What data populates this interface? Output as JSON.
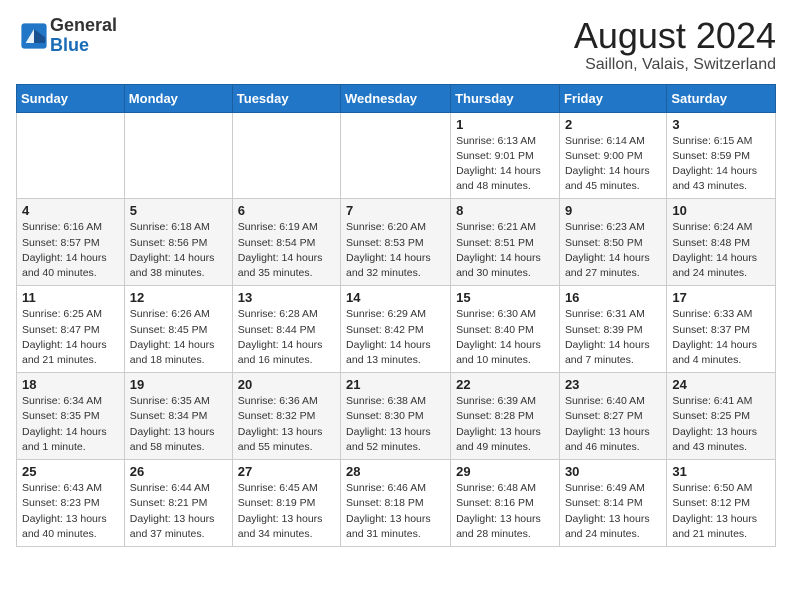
{
  "logo": {
    "line1": "General",
    "line2": "Blue"
  },
  "title": "August 2024",
  "subtitle": "Saillon, Valais, Switzerland",
  "days_of_week": [
    "Sunday",
    "Monday",
    "Tuesday",
    "Wednesday",
    "Thursday",
    "Friday",
    "Saturday"
  ],
  "weeks": [
    [
      {
        "day": "",
        "info": ""
      },
      {
        "day": "",
        "info": ""
      },
      {
        "day": "",
        "info": ""
      },
      {
        "day": "",
        "info": ""
      },
      {
        "day": "1",
        "info": "Sunrise: 6:13 AM\nSunset: 9:01 PM\nDaylight: 14 hours and 48 minutes."
      },
      {
        "day": "2",
        "info": "Sunrise: 6:14 AM\nSunset: 9:00 PM\nDaylight: 14 hours and 45 minutes."
      },
      {
        "day": "3",
        "info": "Sunrise: 6:15 AM\nSunset: 8:59 PM\nDaylight: 14 hours and 43 minutes."
      }
    ],
    [
      {
        "day": "4",
        "info": "Sunrise: 6:16 AM\nSunset: 8:57 PM\nDaylight: 14 hours and 40 minutes."
      },
      {
        "day": "5",
        "info": "Sunrise: 6:18 AM\nSunset: 8:56 PM\nDaylight: 14 hours and 38 minutes."
      },
      {
        "day": "6",
        "info": "Sunrise: 6:19 AM\nSunset: 8:54 PM\nDaylight: 14 hours and 35 minutes."
      },
      {
        "day": "7",
        "info": "Sunrise: 6:20 AM\nSunset: 8:53 PM\nDaylight: 14 hours and 32 minutes."
      },
      {
        "day": "8",
        "info": "Sunrise: 6:21 AM\nSunset: 8:51 PM\nDaylight: 14 hours and 30 minutes."
      },
      {
        "day": "9",
        "info": "Sunrise: 6:23 AM\nSunset: 8:50 PM\nDaylight: 14 hours and 27 minutes."
      },
      {
        "day": "10",
        "info": "Sunrise: 6:24 AM\nSunset: 8:48 PM\nDaylight: 14 hours and 24 minutes."
      }
    ],
    [
      {
        "day": "11",
        "info": "Sunrise: 6:25 AM\nSunset: 8:47 PM\nDaylight: 14 hours and 21 minutes."
      },
      {
        "day": "12",
        "info": "Sunrise: 6:26 AM\nSunset: 8:45 PM\nDaylight: 14 hours and 18 minutes."
      },
      {
        "day": "13",
        "info": "Sunrise: 6:28 AM\nSunset: 8:44 PM\nDaylight: 14 hours and 16 minutes."
      },
      {
        "day": "14",
        "info": "Sunrise: 6:29 AM\nSunset: 8:42 PM\nDaylight: 14 hours and 13 minutes."
      },
      {
        "day": "15",
        "info": "Sunrise: 6:30 AM\nSunset: 8:40 PM\nDaylight: 14 hours and 10 minutes."
      },
      {
        "day": "16",
        "info": "Sunrise: 6:31 AM\nSunset: 8:39 PM\nDaylight: 14 hours and 7 minutes."
      },
      {
        "day": "17",
        "info": "Sunrise: 6:33 AM\nSunset: 8:37 PM\nDaylight: 14 hours and 4 minutes."
      }
    ],
    [
      {
        "day": "18",
        "info": "Sunrise: 6:34 AM\nSunset: 8:35 PM\nDaylight: 14 hours and 1 minute."
      },
      {
        "day": "19",
        "info": "Sunrise: 6:35 AM\nSunset: 8:34 PM\nDaylight: 13 hours and 58 minutes."
      },
      {
        "day": "20",
        "info": "Sunrise: 6:36 AM\nSunset: 8:32 PM\nDaylight: 13 hours and 55 minutes."
      },
      {
        "day": "21",
        "info": "Sunrise: 6:38 AM\nSunset: 8:30 PM\nDaylight: 13 hours and 52 minutes."
      },
      {
        "day": "22",
        "info": "Sunrise: 6:39 AM\nSunset: 8:28 PM\nDaylight: 13 hours and 49 minutes."
      },
      {
        "day": "23",
        "info": "Sunrise: 6:40 AM\nSunset: 8:27 PM\nDaylight: 13 hours and 46 minutes."
      },
      {
        "day": "24",
        "info": "Sunrise: 6:41 AM\nSunset: 8:25 PM\nDaylight: 13 hours and 43 minutes."
      }
    ],
    [
      {
        "day": "25",
        "info": "Sunrise: 6:43 AM\nSunset: 8:23 PM\nDaylight: 13 hours and 40 minutes."
      },
      {
        "day": "26",
        "info": "Sunrise: 6:44 AM\nSunset: 8:21 PM\nDaylight: 13 hours and 37 minutes."
      },
      {
        "day": "27",
        "info": "Sunrise: 6:45 AM\nSunset: 8:19 PM\nDaylight: 13 hours and 34 minutes."
      },
      {
        "day": "28",
        "info": "Sunrise: 6:46 AM\nSunset: 8:18 PM\nDaylight: 13 hours and 31 minutes."
      },
      {
        "day": "29",
        "info": "Sunrise: 6:48 AM\nSunset: 8:16 PM\nDaylight: 13 hours and 28 minutes."
      },
      {
        "day": "30",
        "info": "Sunrise: 6:49 AM\nSunset: 8:14 PM\nDaylight: 13 hours and 24 minutes."
      },
      {
        "day": "31",
        "info": "Sunrise: 6:50 AM\nSunset: 8:12 PM\nDaylight: 13 hours and 21 minutes."
      }
    ]
  ]
}
